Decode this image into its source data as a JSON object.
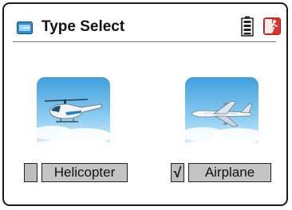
{
  "header": {
    "title": "Type Select",
    "title_icon": "model-type-icon",
    "battery_icon": "battery-icon",
    "exit_icon": "exit-running-man-icon"
  },
  "options": [
    {
      "label": "Helicopter",
      "checked": false,
      "check_mark": "",
      "image": "helicopter-image"
    },
    {
      "label": "Airplane",
      "checked": true,
      "check_mark": "√",
      "image": "airplane-image"
    }
  ],
  "colors": {
    "tile_sky": "#4aa8e0",
    "label_bg": "#c4c4c4",
    "exit_red": "#e0332b"
  }
}
